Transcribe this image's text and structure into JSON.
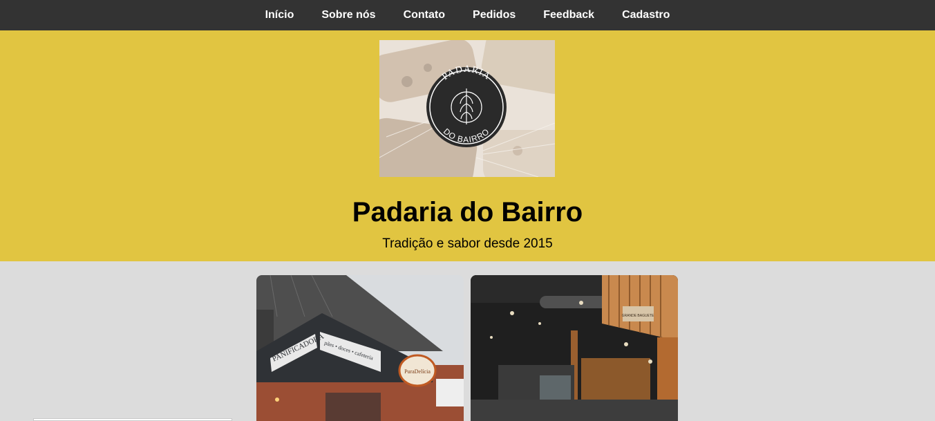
{
  "nav": {
    "items": [
      {
        "label": "Início"
      },
      {
        "label": "Sobre nós"
      },
      {
        "label": "Contato"
      },
      {
        "label": "Pedidos"
      },
      {
        "label": "Feedback"
      },
      {
        "label": "Cadastro"
      }
    ]
  },
  "hero": {
    "logo": {
      "line1": "PADARIA",
      "line2": "DO BAIRRO"
    },
    "title": "Padaria do Bairro",
    "subtitle": "Tradição e sabor desde 2015"
  },
  "gallery": {
    "card1": {
      "sign_left": "PANIFICADORA",
      "sign_right": "pães • doces • cafeteria",
      "brand": "PuraDelícia"
    },
    "card2": {
      "sign": "GRANDE BAGUETE"
    }
  },
  "colors": {
    "nav_bg": "#333333",
    "hero_bg": "#e1c541",
    "page_bg": "#dcdcdc"
  }
}
